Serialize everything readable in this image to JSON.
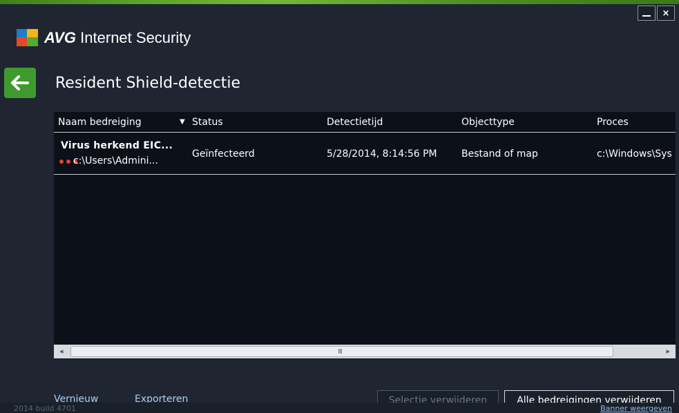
{
  "app": {
    "brand": "AVG",
    "product": "Internet Security",
    "colors": {
      "accent_green": "#3f9a2d",
      "link": "#a9cff2",
      "threat_dot": "#e2452a"
    }
  },
  "window_controls": {
    "minimize_icon": "minimize-icon",
    "close_label": "×"
  },
  "page": {
    "title": "Resident Shield-detectie",
    "back_icon": "arrow-left-icon"
  },
  "table": {
    "columns": [
      "Naam bedreiging",
      "Status",
      "Detectietijd",
      "Objecttype",
      "Proces"
    ],
    "sort_indicator": "▼",
    "rows": [
      {
        "name": "Virus herkend EIC...",
        "path": "c:\\Users\\Admini...",
        "status": "Geïnfecteerd",
        "time": "5/28/2014, 8:14:56 PM",
        "type": "Bestand of map",
        "process": "c:\\Windows\\Sys"
      }
    ],
    "scrollbar": {
      "left_arrow": "◂",
      "right_arrow": "▸",
      "grip": "III"
    }
  },
  "actions": {
    "refresh": "Vernieuw",
    "export": "Exporteren",
    "remove_selected": "Selectie verwijderen",
    "remove_all": "Alle bedreigingen verwijderen"
  },
  "footer": {
    "build": "2014  build 4701",
    "banner": "Banner weergeven"
  }
}
